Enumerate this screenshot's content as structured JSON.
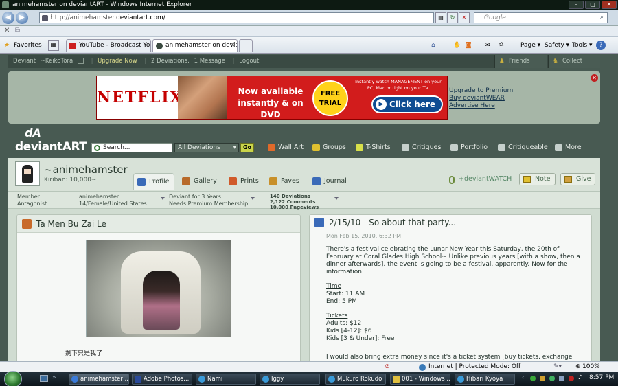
{
  "window": {
    "title": "animehamster on deviantART - Windows Internet Explorer",
    "controls": [
      "–",
      "▢",
      "✕"
    ]
  },
  "addressbar": {
    "url_prefix": "http://animehamster.",
    "url_domain": "deviantart.com/",
    "search_placeholder": "Google"
  },
  "favbar": {
    "favorites_label": "Favorites",
    "tabs": [
      {
        "label": "YouTube - Broadcast Your..."
      },
      {
        "label": "animehamster on devia...",
        "close": "✕"
      }
    ],
    "commands": [
      "Page ▾",
      "Safety ▾",
      "Tools ▾",
      "?"
    ]
  },
  "dabar": {
    "user": "~KeikoTora",
    "user_prefix": "Deviant",
    "upgrade": "Upgrade Now",
    "deviations": "2 Deviations,",
    "messages": "1 Message",
    "logout": "Logout",
    "friends": "Friends",
    "collect": "Collect"
  },
  "ad": {
    "logo": "NETFLIX",
    "now_available": "Now available instantly & on DVD",
    "free_trial": "FREE TRIAL",
    "watch_text": "Instantly watch MANAGEMENT on your PC, Mac or right on your TV.",
    "click_here": "Click here",
    "click_icon": "▶",
    "links": [
      "Upgrade to Premium",
      "Buy deviantWEAR",
      "Advertise Here"
    ],
    "close": "✕"
  },
  "danav": {
    "logo_text": "deviantART",
    "logo_mark": "dA",
    "search_value": "Search...",
    "category": "All Deviations",
    "go": "Go",
    "items": [
      {
        "label": "Wall Art",
        "color": "#e06a2a"
      },
      {
        "label": "Groups",
        "color": "#e0c030"
      },
      {
        "label": "T-Shirts",
        "color": "#d8e04a"
      },
      {
        "label": "Critiques",
        "color": "#c6d0cc"
      },
      {
        "label": "Portfolio",
        "color": "#c6d0cc"
      },
      {
        "label": "Critiqueable",
        "color": "#c6d0cc"
      },
      {
        "label": "More",
        "color": "#c6d0cc"
      }
    ]
  },
  "profile": {
    "username": "~animehamster",
    "kiriban": "Kiriban: 10,000~",
    "tabs": [
      {
        "label": "Profile",
        "color": "#3a6ab8"
      },
      {
        "label": "Gallery",
        "color": "#b86a2a"
      },
      {
        "label": "Prints",
        "color": "#d05a2a"
      },
      {
        "label": "Faves",
        "color": "#c8902a"
      },
      {
        "label": "Journal",
        "color": "#3a6ab8"
      }
    ],
    "watch": "+deviantWATCH",
    "note": "Note",
    "give": "Give",
    "stats": {
      "member": "Member",
      "antagonist": "Antagonist",
      "name": "animehamster",
      "details": "14/Female/United States",
      "deviant_for": "Deviant for 3 Years",
      "membership": "Needs Premium Membership",
      "deviations": "140 Deviations",
      "comments": "2,122 Comments",
      "pageviews": "10,000 Pageviews"
    }
  },
  "left_panel": {
    "title": "Ta Men Bu Zai Le",
    "caption": "剩下只是我了"
  },
  "journal": {
    "title": "2/15/10 - So about that party...",
    "date": "Mon Feb 15, 2010, 6:32 PM",
    "intro": "There's a festival celebrating the Lunar New Year this Saturday, the 20th of February at Coral Glades High School~ Unlike previous years [with a show, then a dinner afterwards], the event is going to be a festival, apparently. Now for the information:",
    "time_head": "Time",
    "time_lines": [
      "Start: 11 AM",
      "End: 5 PM"
    ],
    "tickets_head": "Tickets",
    "tickets_lines": [
      "Adults: $12",
      "Kids [4-12]: $6",
      "Kids [3 & Under]: Free"
    ],
    "closing": "I would also bring extra money since it's a ticket system [buy tickets, exchange tickets, etc]"
  },
  "statusbar": {
    "zone": "Internet | Protected Mode: Off",
    "zoom": "100%"
  },
  "taskbar": {
    "tasks": [
      {
        "label": "animehamster ...",
        "color": "#3a7ad8"
      },
      {
        "label": "Adobe Photos...",
        "color": "#2a4a9a"
      },
      {
        "label": "Nami",
        "color": "#3a9ad8"
      },
      {
        "label": "Iggy",
        "color": "#3a9ad8"
      },
      {
        "label": "Mukuro Rokudo",
        "color": "#3a9ad8"
      },
      {
        "label": "001 - Windows ...",
        "color": "#e0c040"
      },
      {
        "label": "Hibari Kyoya",
        "color": "#3a9ad8"
      }
    ],
    "clock": "8:57 PM"
  }
}
